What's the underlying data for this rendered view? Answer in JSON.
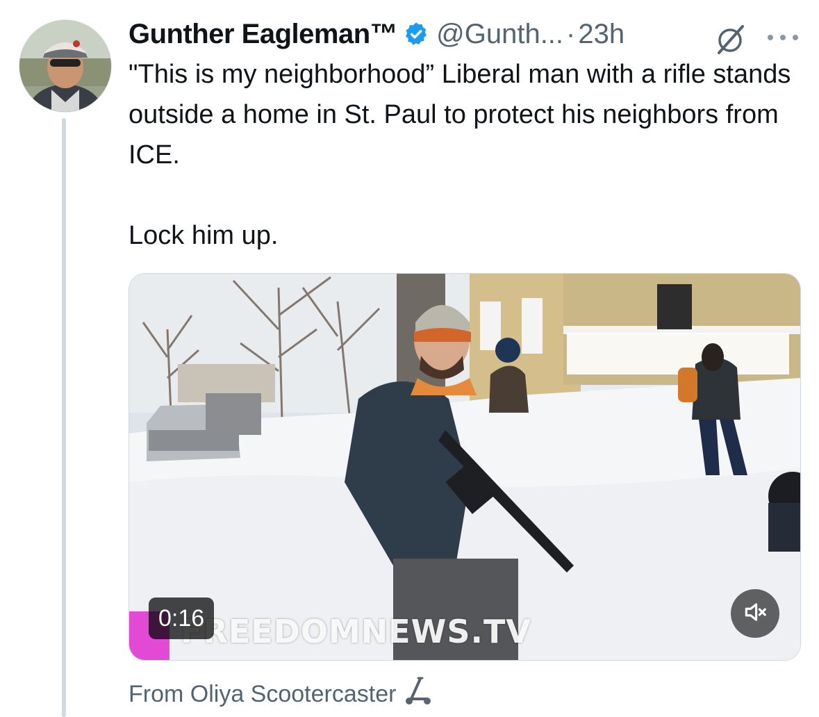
{
  "author": {
    "display_name": "Gunther Eagleman™",
    "handle": "@Gunth...",
    "separator": "·",
    "timestamp": "23h",
    "verified_color": "#1d9bf0"
  },
  "tweet": {
    "paragraphs": [
      "\"This is my neighborhood” Liberal man with a rifle stands outside a home in St. Paul to protect his neighbors from ICE.",
      "Lock him up."
    ]
  },
  "media": {
    "duration": "0:16",
    "watermark": "FREEDOMNEWS.TV",
    "mute_icon": "speaker-muted-icon"
  },
  "attribution": {
    "text": "From Oliya Scootercaster",
    "emoji": "scooter-icon"
  },
  "icons": {
    "grok": "grok-icon",
    "more": "more-icon"
  },
  "colors": {
    "text_primary": "#0f1419",
    "text_secondary": "#536471",
    "thread_line": "#cfd9de",
    "watermark_tag": "#e24ad6"
  }
}
